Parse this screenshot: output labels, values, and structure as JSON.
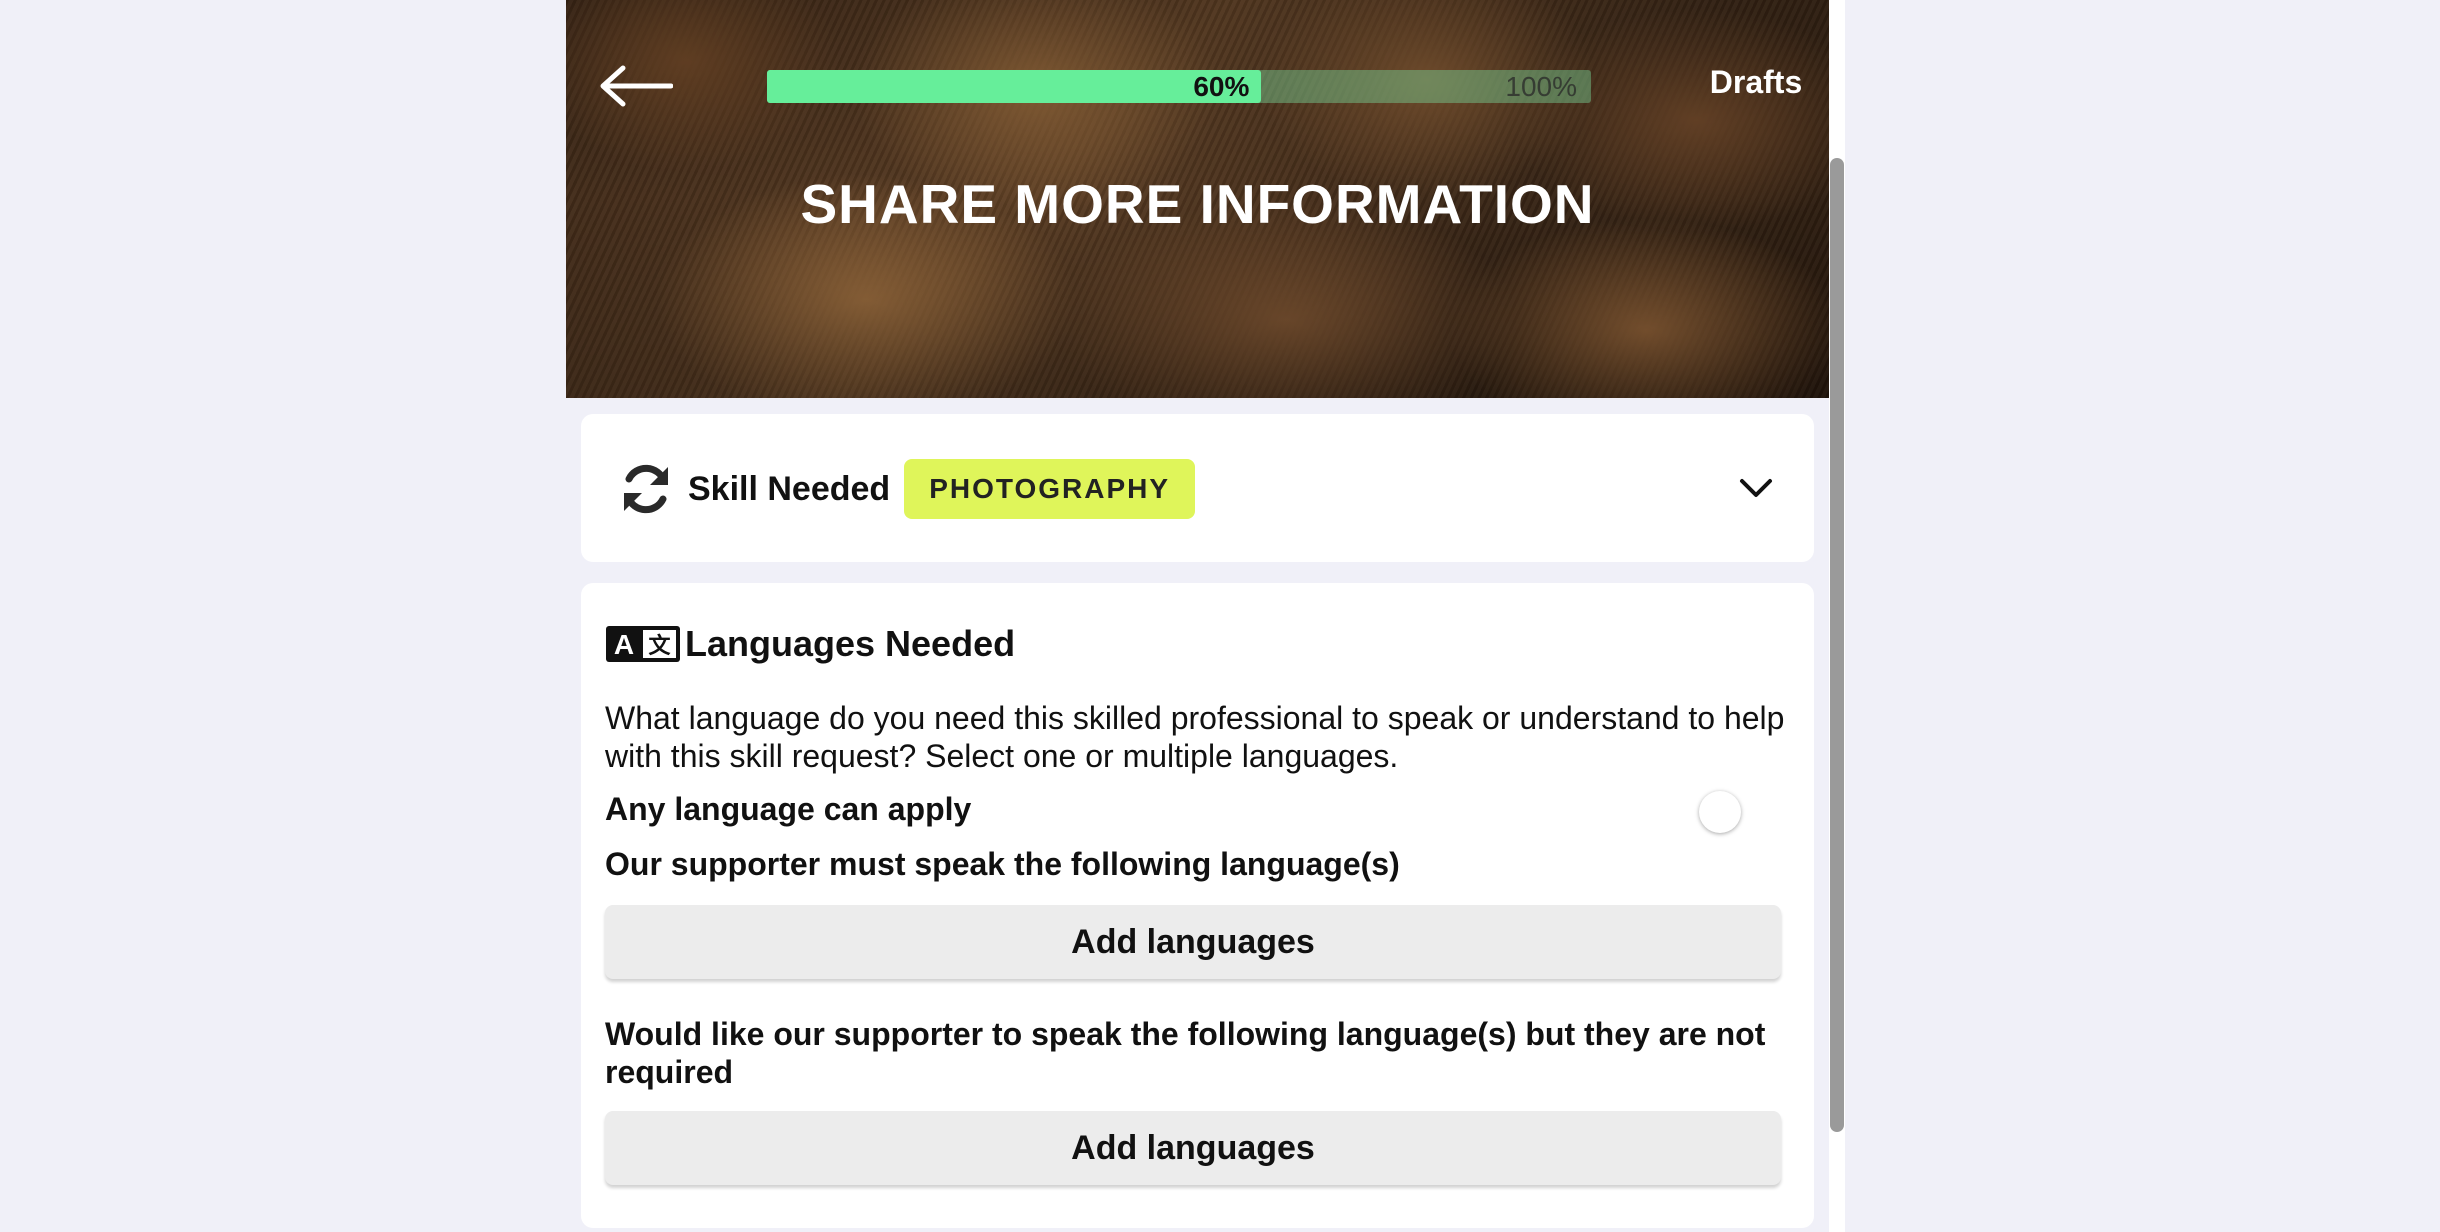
{
  "header": {
    "back_icon": "arrow-left-icon",
    "progress": {
      "current_label": "60%",
      "total_label": "100%",
      "fraction": 0.6
    },
    "drafts_label": "Drafts",
    "title": "SHARE MORE INFORMATION"
  },
  "skill": {
    "icon": "refresh-icon",
    "label": "Skill Needed",
    "tag": "PHOTOGRAPHY",
    "tag_color": "#dff55a",
    "chevron_icon": "chevron-down-icon"
  },
  "languages": {
    "icon": "translate-icon",
    "title": "Languages Needed",
    "description": "What language do you need this skilled professional to speak or understand to help with this skill request? Select one or multiple languages.",
    "any_language_label": "Any language can apply",
    "any_language_enabled": false,
    "must_speak_label": "Our supporter must speak the following language(s)",
    "add_languages_required": "Add languages",
    "would_like_label": "Would like our supporter to speak the following language(s) but they are not required",
    "add_languages_optional": "Add languages"
  },
  "colors": {
    "progress_fill": "#66ee9a",
    "background": "#f0f0f8"
  }
}
